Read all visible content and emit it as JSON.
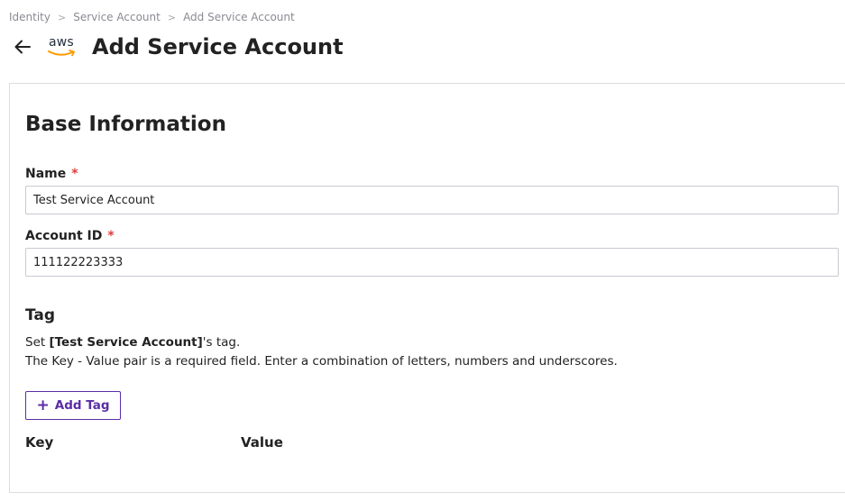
{
  "breadcrumb": {
    "items": [
      "Identity",
      "Service Account",
      "Add Service Account"
    ],
    "separator": ">"
  },
  "header": {
    "back_icon": "arrow-left-icon",
    "logo_text": "aws",
    "title": "Add Service Account"
  },
  "form": {
    "section_title": "Base Information",
    "name_label": "Name",
    "name_value": "Test Service Account",
    "account_id_label": "Account ID",
    "account_id_value": "111122223333",
    "required_mark": "*"
  },
  "tag": {
    "title": "Tag",
    "desc_prefix": "Set ",
    "desc_bold": "[Test Service Account]",
    "desc_suffix": "'s tag.",
    "desc_line2": "The Key - Value pair is a required field. Enter a combination of letters, numbers and underscores.",
    "add_button_plus": "+",
    "add_button_label": "Add Tag",
    "key_header": "Key",
    "value_header": "Value"
  },
  "colors": {
    "accent": "#5a2ea6",
    "required": "#e23b3b",
    "aws_orange": "#ff9900"
  }
}
